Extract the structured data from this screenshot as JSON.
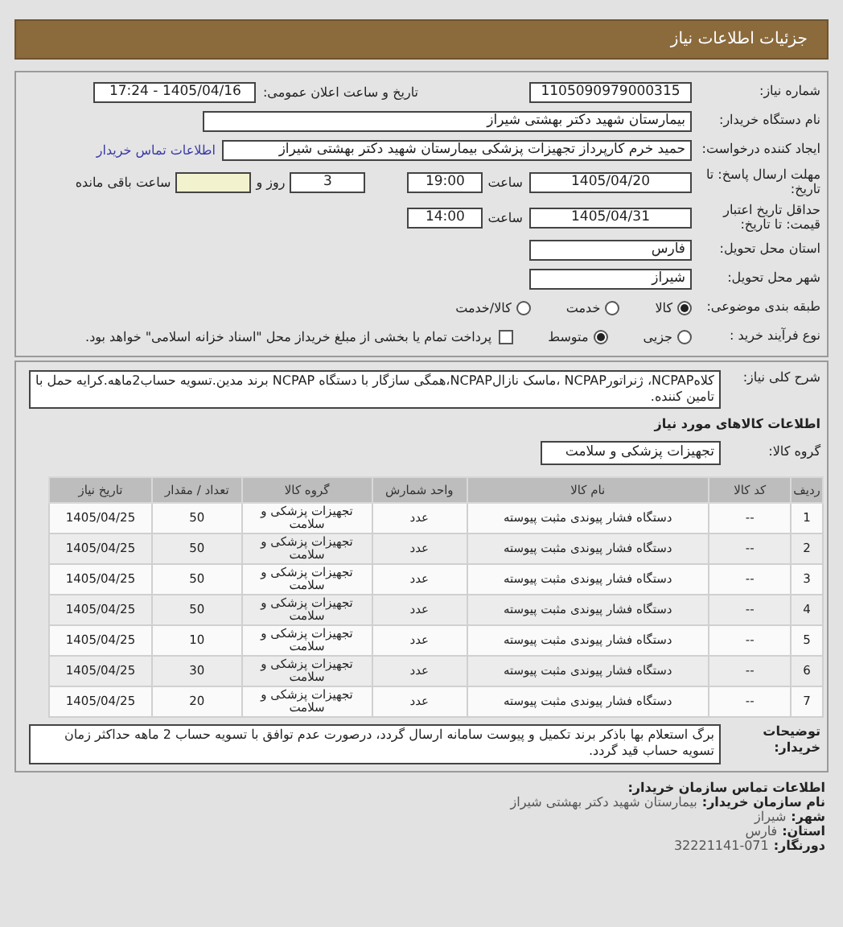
{
  "header": {
    "title": "جزئیات اطلاعات نیاز"
  },
  "need_number": {
    "label": "شماره نیاز:",
    "value": "1105090979000315"
  },
  "announce": {
    "label": "تاریخ و ساعت اعلان عمومی:",
    "value": "1405/04/16 - 17:24"
  },
  "buyer": {
    "label": "نام دستگاه خریدار:",
    "value": "بیمارستان شهید دکتر بهشتی شیراز"
  },
  "requester": {
    "label": "ایجاد کننده درخواست:",
    "value": "حمید خرم کارپرداز تجهیزات پزشکی بیمارستان شهید دکتر بهشتی شیراز",
    "link": "اطلاعات تماس خریدار"
  },
  "deadline": {
    "label": "مهلت ارسال پاسخ: تا تاریخ:",
    "date": "1405/04/20",
    "time_label": "ساعت",
    "time": "19:00",
    "days": "3",
    "days_label": "روز و",
    "remaining_label": "ساعت باقی مانده"
  },
  "validity": {
    "label": "حداقل تاریخ اعتبار قیمت: تا تاریخ:",
    "date": "1405/04/31",
    "time_label": "ساعت",
    "time": "14:00"
  },
  "province": {
    "label": "استان محل تحویل:",
    "value": "فارس"
  },
  "city": {
    "label": "شهر محل تحویل:",
    "value": "شیراز"
  },
  "category": {
    "label": "طبقه بندی موضوعی:",
    "options": [
      {
        "label": "کالا",
        "selected": true
      },
      {
        "label": "خدمت",
        "selected": false
      },
      {
        "label": "کالا/خدمت",
        "selected": false
      }
    ]
  },
  "purchase_type": {
    "label": "نوع فرآیند خرید :",
    "options": [
      {
        "label": "جزیی",
        "selected": false
      },
      {
        "label": "متوسط",
        "selected": true
      }
    ],
    "treasury": {
      "checked": false,
      "text": "پرداخت تمام یا بخشی از مبلغ خریداز محل \"اسناد خزانه اسلامی\" خواهد بود."
    }
  },
  "description": {
    "label": "شرح کلی نیاز:",
    "text": "کلاهNCPAP، ژنراتورNCPAP ،ماسک نازالNCPAP،همگی سازگار با دستگاه NCPAP برند مدین.تسویه حساب2ماهه.کرایه حمل با تامین کننده."
  },
  "goods_heading": "اطلاعات کالاهای مورد نیاز",
  "goods_group": {
    "label": "گروه کالا:",
    "value": "تجهیزات پزشکی و سلامت"
  },
  "table": {
    "columns": [
      "ردیف",
      "کد کالا",
      "نام کالا",
      "واحد شمارش",
      "گروه کالا",
      "تعداد / مقدار",
      "تاریخ نیاز"
    ],
    "rows": [
      [
        "1",
        "--",
        "دستگاه فشار پیوندی مثبت پیوسته",
        "عدد",
        "تجهیزات پزشکی و سلامت",
        "50",
        "1405/04/25"
      ],
      [
        "2",
        "--",
        "دستگاه فشار پیوندی مثبت پیوسته",
        "عدد",
        "تجهیزات پزشکی و سلامت",
        "50",
        "1405/04/25"
      ],
      [
        "3",
        "--",
        "دستگاه فشار پیوندی مثبت پیوسته",
        "عدد",
        "تجهیزات پزشکی و سلامت",
        "50",
        "1405/04/25"
      ],
      [
        "4",
        "--",
        "دستگاه فشار پیوندی مثبت پیوسته",
        "عدد",
        "تجهیزات پزشکی و سلامت",
        "50",
        "1405/04/25"
      ],
      [
        "5",
        "--",
        "دستگاه فشار پیوندی مثبت پیوسته",
        "عدد",
        "تجهیزات پزشکی و سلامت",
        "10",
        "1405/04/25"
      ],
      [
        "6",
        "--",
        "دستگاه فشار پیوندی مثبت پیوسته",
        "عدد",
        "تجهیزات پزشکی و سلامت",
        "30",
        "1405/04/25"
      ],
      [
        "7",
        "--",
        "دستگاه فشار پیوندی مثبت پیوسته",
        "عدد",
        "تجهیزات پزشکی و سلامت",
        "20",
        "1405/04/25"
      ]
    ]
  },
  "notes": {
    "label": "توضیحات خریدار:",
    "text": "برگ استعلام بها باذکر برند تکمیل و پیوست سامانه ارسال گردد، درصورت عدم توافق با تسویه حساب 2 ماهه حداکثر زمان تسویه حساب قید گردد."
  },
  "contact": {
    "title": "اطلاعات تماس سازمان خریدار:",
    "lines": [
      {
        "label": "نام سازمان خریدار:",
        "value": "بیمارستان شهید دکتر بهشتی شیراز"
      },
      {
        "label": "شهر:",
        "value": "شیراز"
      },
      {
        "label": "استان:",
        "value": "فارس"
      },
      {
        "label": "دورنگار:",
        "value": "32221141-071"
      }
    ]
  }
}
